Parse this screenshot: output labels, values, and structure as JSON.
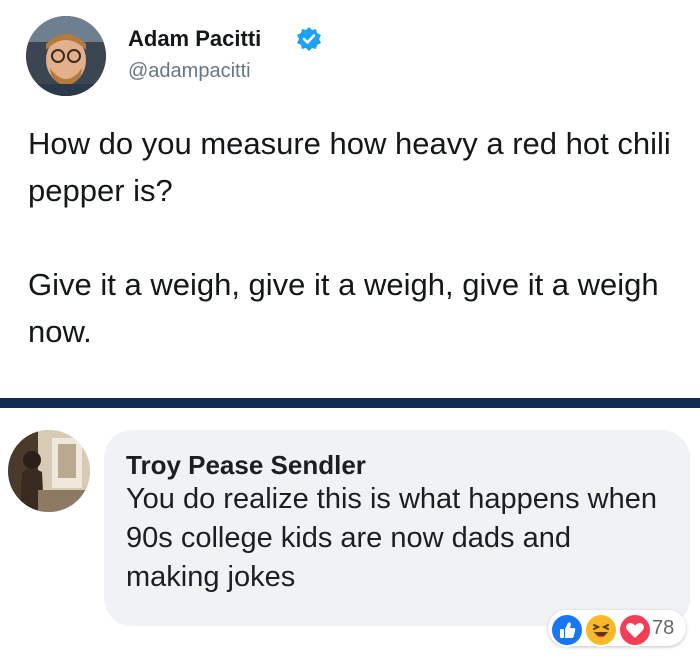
{
  "tweet": {
    "author_name": "Adam Pacitti",
    "handle": "@adampacitti",
    "text": "How do you measure how heavy a red hot chili pepper is?\n\nGive it a weigh, give it a weigh, give it a weigh now.",
    "verified_color": "#1da1f2"
  },
  "comment": {
    "author_name": "Troy Pease Sendler",
    "text": "You do realize this is what happens when 90s college kids are now dads and making jokes",
    "reactions": {
      "icons": [
        "like-icon",
        "haha-icon",
        "love-icon"
      ],
      "count": "78"
    }
  },
  "colors": {
    "divider": "#0f2b4e",
    "bubble": "#f0f2f5",
    "like": "#1877f2",
    "haha": "#f7b928",
    "love": "#f33e58"
  }
}
